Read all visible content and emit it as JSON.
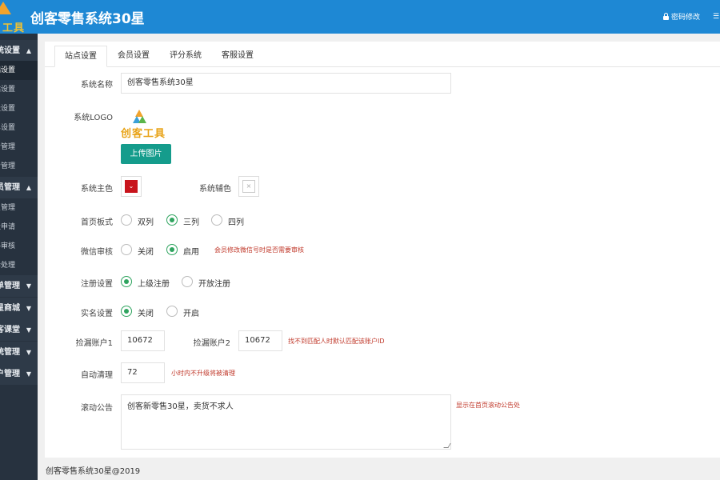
{
  "header": {
    "logo_text": "工具",
    "title": "创客零售系统30星",
    "change_password": "密码修改",
    "menu_icon": "menu-icon"
  },
  "sidebar": {
    "items": [
      {
        "type": "group",
        "label": "统设置",
        "arrow": "▲"
      },
      {
        "type": "sub",
        "label": "基础设置",
        "active": true
      },
      {
        "type": "sub",
        "label": "站设置"
      },
      {
        "type": "sub",
        "label": "级设置"
      },
      {
        "type": "sub",
        "label": "单设置"
      },
      {
        "type": "sub",
        "label": "告管理"
      },
      {
        "type": "sub",
        "label": "告管理"
      },
      {
        "type": "group",
        "label": "会员管理",
        "arrow": "▲"
      },
      {
        "type": "sub",
        "label": "员管理"
      },
      {
        "type": "sub",
        "label": "级申请"
      },
      {
        "type": "sub",
        "label": "料审核"
      },
      {
        "type": "sub",
        "label": "诉处理"
      },
      {
        "type": "group",
        "label": "单管理",
        "arrow": "▼"
      },
      {
        "type": "group",
        "label": "星商城",
        "arrow": "▼"
      },
      {
        "type": "group",
        "label": "客课堂",
        "arrow": "▼"
      },
      {
        "type": "group",
        "label": "统管理",
        "arrow": "▼"
      },
      {
        "type": "group",
        "label": "户管理",
        "arrow": "▼"
      }
    ]
  },
  "tabs": [
    "站点设置",
    "会员设置",
    "评分系统",
    "客服设置"
  ],
  "form": {
    "system_name_label": "系统名称",
    "system_name_value": "创客零售系统30星",
    "system_logo_label": "系统LOGO",
    "logo_text": "创客工具",
    "upload_button": "上传图片",
    "main_color_label": "系统主色",
    "main_color": "#c8141c",
    "sub_color_label": "系统辅色",
    "homepage_layout_label": "首页板式",
    "homepage_layout_options": [
      "双列",
      "三列",
      "四列"
    ],
    "homepage_layout_selected": "三列",
    "wechat_review_label": "微信审核",
    "wechat_review_options": [
      "关闭",
      "启用"
    ],
    "wechat_review_selected": "启用",
    "wechat_review_note": "会员修改微信号时是否需要审核",
    "register_label": "注册设置",
    "register_options": [
      "上级注册",
      "开放注册"
    ],
    "register_selected": "上级注册",
    "realname_label": "实名设置",
    "realname_options": [
      "关闭",
      "开启"
    ],
    "realname_selected": "关闭",
    "leak_account1_label": "捡漏账户1",
    "leak_account1_value": "10672",
    "leak_account2_label": "捡漏账户2",
    "leak_account2_value": "10672",
    "leak_account_note": "找不到匹配人时默认匹配该账户ID",
    "auto_clean_label": "自动清理",
    "auto_clean_value": "72",
    "auto_clean_note": "小时内不升级将被清理",
    "scroll_notice_label": "滚动公告",
    "scroll_notice_value": "创客新零售30星，卖货不求人",
    "scroll_notice_note": "显示在首页滚动公告处"
  },
  "footer": {
    "copyright": "创客零售系统30星@2019"
  },
  "colors": {
    "header_bg": "#1e88d4",
    "sidebar_bg": "#27323f",
    "accent_green": "#2fa45f",
    "button_teal": "#159c8c",
    "note_red": "#c0392b"
  }
}
